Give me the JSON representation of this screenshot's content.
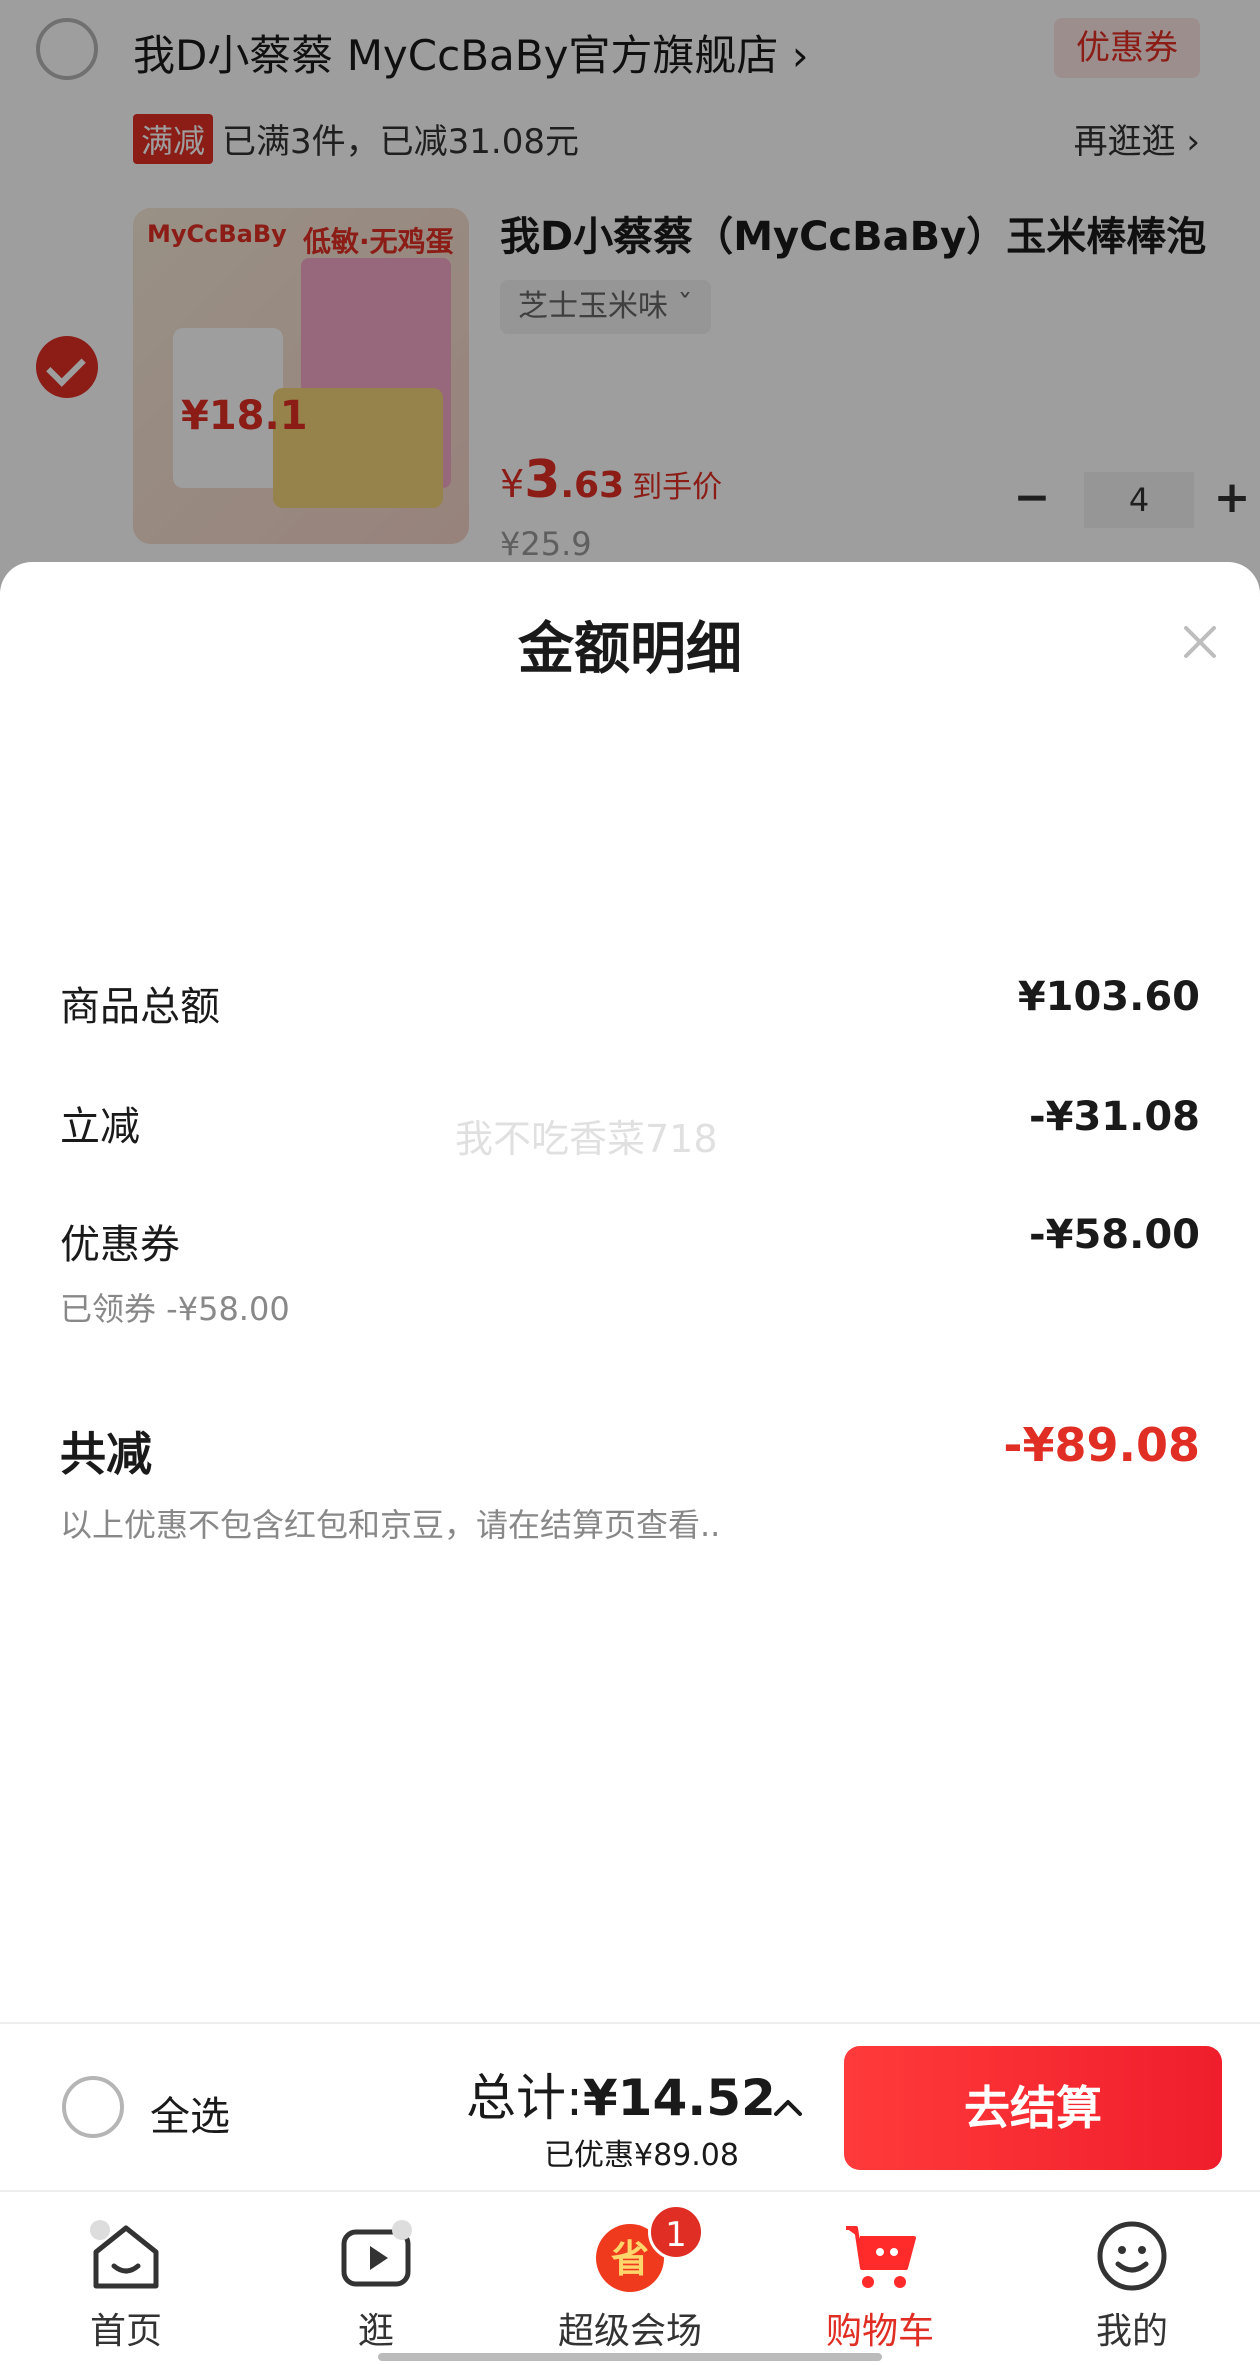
{
  "cart": {
    "shop_name": "我D小蔡蔡 MyCcBaBy官方旗舰店 ›",
    "coupon_tag": "优惠券",
    "promo_tag": "满减",
    "promo_text": "已满3件，已减31.08元",
    "promo_more": "再逛逛 ›",
    "product": {
      "title": "我D小蔡蔡（MyCcBaBy）玉米棒棒泡",
      "sku": "芝士玉米味 ˇ",
      "price_currency": "¥",
      "price_int": "3",
      "price_dec": ".63",
      "price_label": "到手价",
      "orig_price": "¥25.9",
      "quantity": "4",
      "minus": "−",
      "plus": "+",
      "image_text": {
        "logo": "MyCcBaBy",
        "headline": "低敏·无鸡蛋",
        "price": "¥18.1"
      }
    }
  },
  "sheet": {
    "title": "金额明细",
    "close_icon": "close-icon",
    "items": [
      {
        "label": "商品总额",
        "value": "¥103.60"
      },
      {
        "label": "立减",
        "value": "-¥31.08"
      },
      {
        "label": "优惠券",
        "value": "-¥58.00"
      }
    ],
    "coupon_note": "已领券 -¥58.00",
    "total_label": "共减",
    "total_value": "-¥89.08",
    "disclaimer": "以上优惠不包含红包和京豆，请在结算页查看..",
    "watermark": "我不吃香菜718"
  },
  "checkout": {
    "select_all": "全选",
    "total_prefix": "总计:",
    "total_amount": "¥14.52",
    "saved": "已优惠¥89.08",
    "button": "去结算"
  },
  "nav": {
    "items": [
      {
        "label": "首页",
        "icon": "home-icon"
      },
      {
        "label": "逛",
        "icon": "video-play-icon"
      },
      {
        "label": "超级会场",
        "icon": "super-venue-icon",
        "badge": "1"
      },
      {
        "label": "购物车",
        "icon": "cart-icon"
      },
      {
        "label": "我的",
        "icon": "profile-face-icon"
      }
    ]
  },
  "colors": {
    "accent": "#e02e24",
    "button": "#f01e2c"
  }
}
